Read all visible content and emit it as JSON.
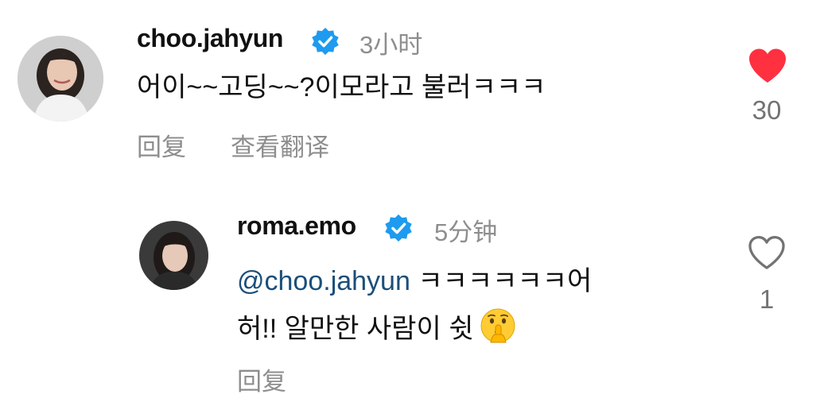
{
  "comments": [
    {
      "username": "choo.jahyun",
      "time": "3小时",
      "text": "어이~~고딩~~?이모라고 불러ㅋㅋㅋ",
      "actions": {
        "reply": "回复",
        "translate": "查看翻译"
      },
      "likes": "30",
      "liked": true,
      "verified": true
    },
    {
      "username": "roma.emo",
      "time": "5分钟",
      "mention": "@choo.jahyun",
      "text_line1": " ㅋㅋㅋㅋㅋㅋ어",
      "text_line2": "허!! 알만한 사람이 쉿",
      "emoji": "shushing-face",
      "actions": {
        "reply": "回复"
      },
      "likes": "1",
      "liked": false,
      "verified": true
    }
  ],
  "colors": {
    "verified": "#1d9bf0",
    "like_active": "#ff3040",
    "secondary_text": "#8e8e8e",
    "mention": "#1a4e7a"
  }
}
